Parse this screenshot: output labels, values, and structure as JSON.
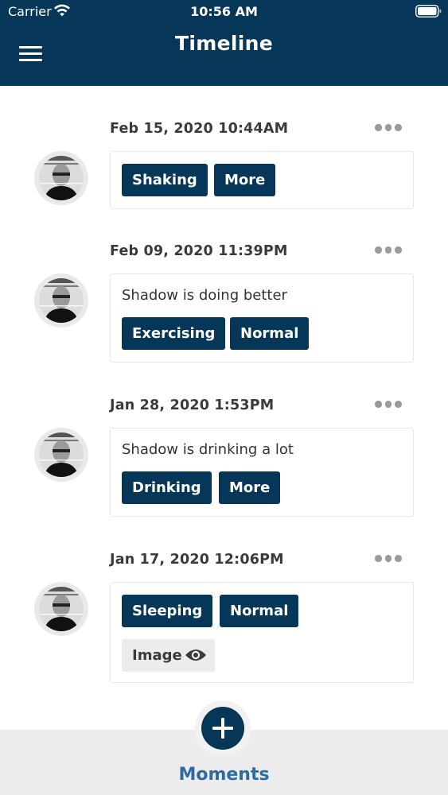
{
  "status_bar": {
    "carrier": "Carrier",
    "time": "10:56 AM"
  },
  "header": {
    "title": "Timeline"
  },
  "entries": [
    {
      "date": "Feb 15, 2020 10:44AM",
      "note": "",
      "tags": [
        "Shaking",
        "More"
      ]
    },
    {
      "date": "Feb 09, 2020 11:39PM",
      "note": "Shadow is doing better",
      "tags": [
        "Exercising",
        "Normal"
      ]
    },
    {
      "date": "Jan 28, 2020 1:53PM",
      "note": "Shadow is drinking a lot",
      "tags": [
        "Drinking",
        "More"
      ]
    },
    {
      "date": "Jan 17, 2020 12:06PM",
      "note": "",
      "tags": [
        "Sleeping",
        "Normal"
      ],
      "image_label": "Image"
    }
  ],
  "tab_bar": {
    "label": "Moments"
  },
  "colors": {
    "primary": "#063759",
    "tab_accent": "#2d6ba1",
    "tab_bar_bg": "#ececec"
  },
  "icons": [
    "menu-icon",
    "more-icon",
    "eye-icon",
    "plus-icon",
    "wifi-icon",
    "battery-icon"
  ]
}
